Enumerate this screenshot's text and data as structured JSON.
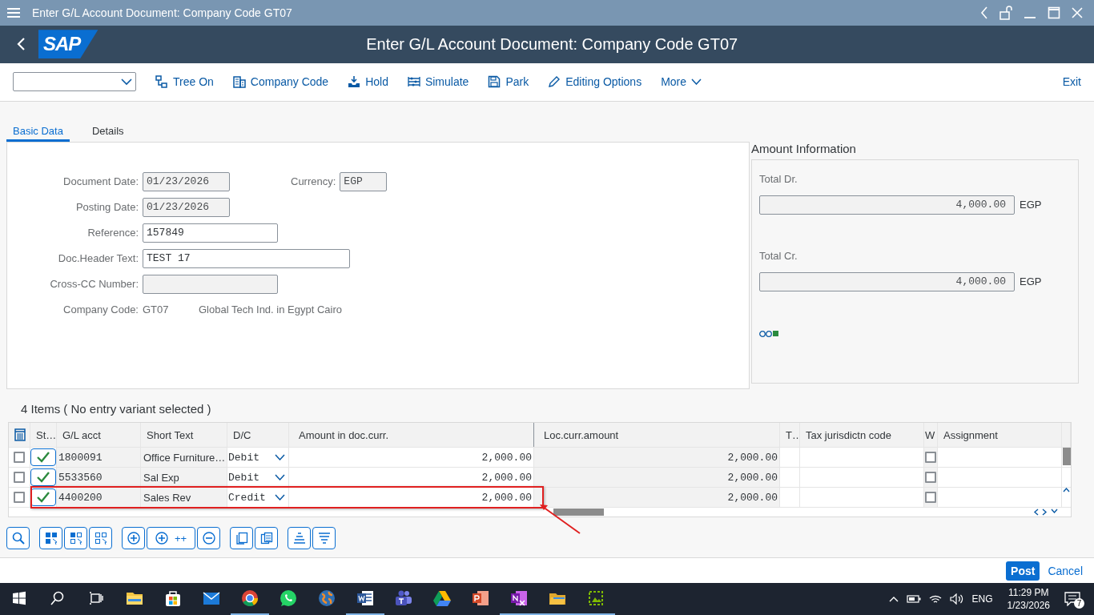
{
  "window": {
    "title": "Enter G/L Account Document: Company Code GT07"
  },
  "header": {
    "logo": "SAP",
    "title": "Enter G/L Account Document: Company Code GT07"
  },
  "toolbar": {
    "items": [
      {
        "kind": "tree",
        "label": "Tree On"
      },
      {
        "kind": "company",
        "label": "Company Code"
      },
      {
        "kind": "hold",
        "label": "Hold"
      },
      {
        "kind": "simulate",
        "label": "Simulate"
      },
      {
        "kind": "park",
        "label": "Park"
      },
      {
        "kind": "edit",
        "label": "Editing Options"
      }
    ],
    "more": "More",
    "exit": "Exit"
  },
  "tabs": [
    {
      "label": "Basic Data",
      "selected": true
    },
    {
      "label": "Details",
      "selected": false
    }
  ],
  "document_header": {
    "rows": [
      {
        "fields": [
          {
            "label": "Document Date:",
            "value": "01/23/2026",
            "editable": false
          },
          {
            "label": "Currency:",
            "value": "EGP",
            "editable": false
          }
        ]
      },
      {
        "fields": [
          {
            "label": "Posting Date:",
            "value": "01/23/2026",
            "editable": false
          }
        ]
      },
      {
        "fields": [
          {
            "label": "Reference:",
            "value": "157849",
            "editable": true
          }
        ]
      },
      {
        "fields": [
          {
            "label": "Doc.Header Text:",
            "value": "TEST 17",
            "editable": true
          }
        ]
      },
      {
        "fields": [
          {
            "label": "Cross-CC Number:",
            "editable": false
          }
        ]
      }
    ],
    "company_code": {
      "label": "Company Code:",
      "code": "GT07",
      "name": "Global Tech Ind. in Egypt Cairo"
    }
  },
  "amount_information": {
    "title": "Amount Information",
    "totals": [
      {
        "label": "Total Dr.",
        "value": "4,000.00",
        "currency": "EGP"
      },
      {
        "label": "Total Cr.",
        "value": "4,000.00",
        "currency": "EGP"
      }
    ],
    "balanced": true
  },
  "items": {
    "title": "4 Items ( No entry variant selected )",
    "columns": [
      "St…",
      "G/L acct",
      "Short Text",
      "D/C",
      "Amount in doc.curr.",
      "Loc.curr.amount",
      "T…",
      "Tax jurisdictn code",
      "W",
      "Assignment"
    ],
    "rows": [
      {
        "selected": false,
        "valid": true,
        "gl_acct": "1800091",
        "short_text": "Office Furniture…",
        "dc": "Debit",
        "amount": "2,000.00",
        "loc_amount": "2,000.00",
        "w_checked": false,
        "highlighted": false
      },
      {
        "selected": false,
        "valid": true,
        "gl_acct": "5533560",
        "short_text": "Sal Exp",
        "dc": "Debit",
        "amount": "2,000.00",
        "loc_amount": "2,000.00",
        "w_checked": false,
        "highlighted": false
      },
      {
        "selected": false,
        "valid": true,
        "gl_acct": "4400200",
        "short_text": "Sales Rev",
        "dc": "Credit",
        "amount": "2,000.00",
        "loc_amount": "2,000.00",
        "w_checked": false,
        "highlighted": true
      }
    ]
  },
  "table_toolbar": {
    "add_multiple_label": "++"
  },
  "footer": {
    "post": "Post",
    "cancel": "Cancel"
  },
  "taskbar": {
    "apps": [
      {
        "kind": "explorer",
        "running": false
      },
      {
        "kind": "store",
        "running": false
      },
      {
        "kind": "mail",
        "running": false
      },
      {
        "kind": "chrome",
        "running": true
      },
      {
        "kind": "whatsapp",
        "running": false
      },
      {
        "kind": "globe",
        "running": false
      },
      {
        "kind": "word",
        "running": true
      },
      {
        "kind": "teams",
        "running": false
      },
      {
        "kind": "drive",
        "running": false
      },
      {
        "kind": "powerpoint",
        "running": false
      },
      {
        "kind": "onenote",
        "running": true
      },
      {
        "kind": "folder",
        "running": true
      },
      {
        "kind": "snip",
        "running": true
      }
    ],
    "language": "ENG",
    "time": "11:29 PM",
    "date": "1/23/2026",
    "notifications": "7"
  }
}
